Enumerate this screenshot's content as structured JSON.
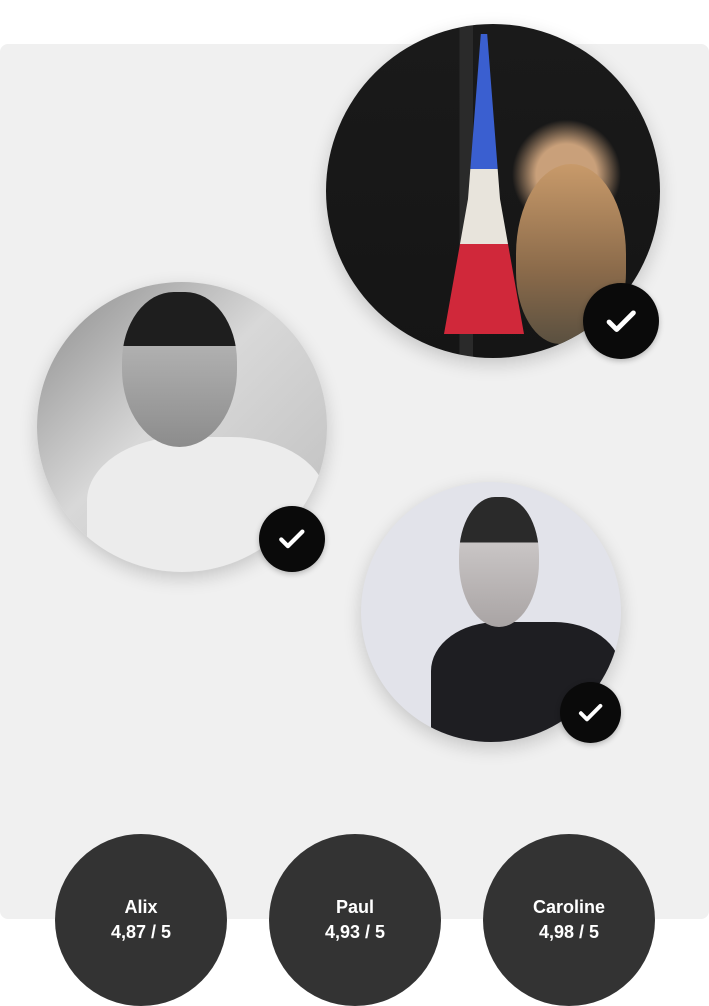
{
  "profiles": [
    {
      "name": "Alix",
      "rating": "4,87 / 5",
      "verified": true
    },
    {
      "name": "Paul",
      "rating": "4,93 / 5",
      "verified": true
    },
    {
      "name": "Caroline",
      "rating": "4,98 / 5",
      "verified": true
    }
  ],
  "colors": {
    "panel": "#f0f0f0",
    "score_bg": "#333333",
    "check_bg": "#0a0a0a"
  }
}
